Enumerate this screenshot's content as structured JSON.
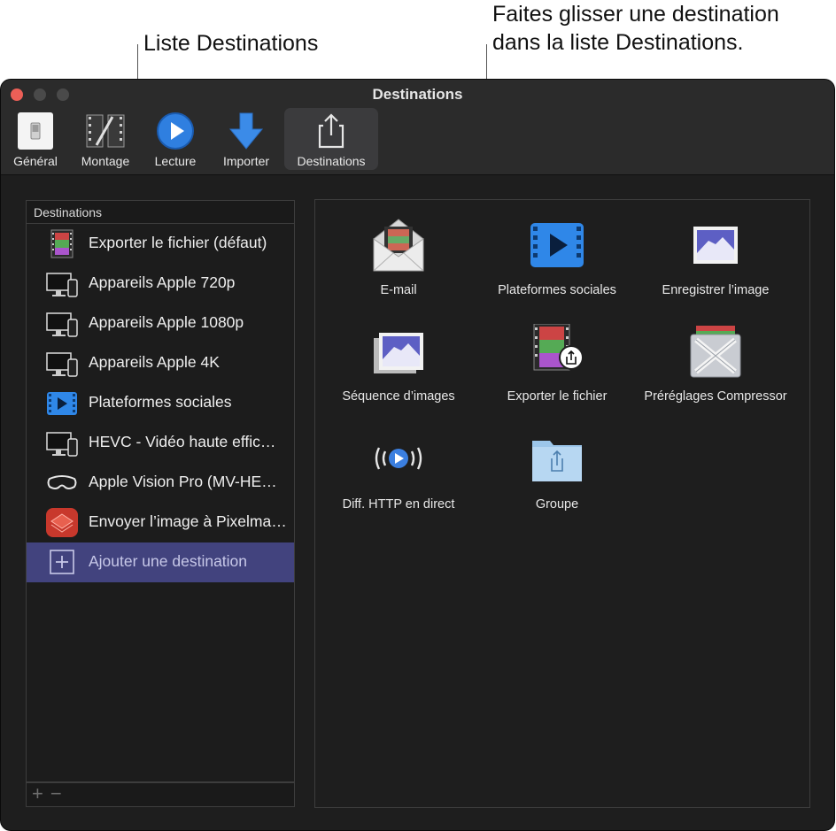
{
  "callouts": {
    "left": "Liste Destinations",
    "right_line1": "Faites glisser une destination",
    "right_line2": "dans la liste Destinations."
  },
  "window": {
    "title": "Destinations"
  },
  "toolbar": [
    {
      "label": "Général",
      "icon": "general-switch-icon"
    },
    {
      "label": "Montage",
      "icon": "film-edit-icon"
    },
    {
      "label": "Lecture",
      "icon": "play-icon"
    },
    {
      "label": "Importer",
      "icon": "download-arrow-icon"
    },
    {
      "label": "Destinations",
      "icon": "share-icon",
      "active": true
    }
  ],
  "destinations_list": {
    "header": "Destinations",
    "items": [
      {
        "label": "Exporter le fichier (défaut)",
        "icon": "export-file-icon"
      },
      {
        "label": "Appareils Apple 720p",
        "icon": "apple-devices-icon"
      },
      {
        "label": "Appareils Apple 1080p",
        "icon": "apple-devices-icon"
      },
      {
        "label": "Appareils Apple 4K",
        "icon": "apple-devices-icon"
      },
      {
        "label": "Plateformes sociales",
        "icon": "social-platforms-icon"
      },
      {
        "label": "HEVC - Vidéo haute effic…",
        "icon": "apple-devices-icon"
      },
      {
        "label": "Apple Vision Pro (MV-HE…",
        "icon": "vision-pro-icon"
      },
      {
        "label": "Envoyer l’image à Pixelma…",
        "icon": "pixelmator-icon"
      },
      {
        "label": "Ajouter une destination",
        "icon": "add-destination-icon",
        "selected": true
      }
    ],
    "footer": {
      "add": "+",
      "remove": "−"
    }
  },
  "destination_tiles": [
    {
      "label": "E-mail",
      "icon": "email-envelope-icon"
    },
    {
      "label": "Plateformes sociales",
      "icon": "social-platforms-icon"
    },
    {
      "label": "Enregistrer l’image",
      "icon": "save-image-icon"
    },
    {
      "label": "Séquence d’images",
      "icon": "image-sequence-icon"
    },
    {
      "label": "Exporter le fichier",
      "icon": "export-file-icon"
    },
    {
      "label": "Préréglages Compressor",
      "icon": "compressor-icon"
    },
    {
      "label": "Diff. HTTP en direct",
      "icon": "http-live-icon"
    },
    {
      "label": "Groupe",
      "icon": "group-folder-icon"
    }
  ],
  "colors": {
    "selection": "#42437e",
    "window_bg": "#1e1e1e",
    "close_button": "#ec5f57",
    "accent_blue": "#2f7fe0"
  }
}
